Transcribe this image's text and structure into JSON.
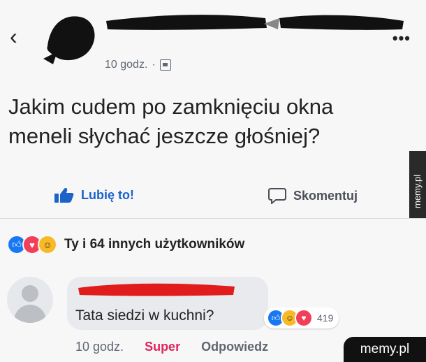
{
  "header": {
    "back_icon": "chevron-left-icon",
    "time": "10 godz.",
    "separator": "·",
    "privacy_icon": "friends-icon",
    "more_label": "•••"
  },
  "post": {
    "text_line1": "Jakim cudem po zamknięciu okna",
    "text_line2": "meneli słychać jeszcze głośniej?"
  },
  "actions": {
    "like_label": "Lubię to!",
    "comment_label": "Skomentuj"
  },
  "reactions": {
    "icons": [
      "like",
      "love",
      "haha"
    ],
    "summary": "Ty i 64 innych użytkowników"
  },
  "comment": {
    "text": "Tata siedzi w kuchni?",
    "reaction_count": "419",
    "time": "10 godz.",
    "super_label": "Super",
    "reply_label": "Odpowiedz"
  },
  "watermark": {
    "side": "memy.pl",
    "corner": "memy.pl"
  },
  "colors": {
    "like_blue": "#1b62c9",
    "love_red": "#f33e58",
    "haha_yellow": "#f7b928",
    "super_pink": "#e0245e"
  }
}
